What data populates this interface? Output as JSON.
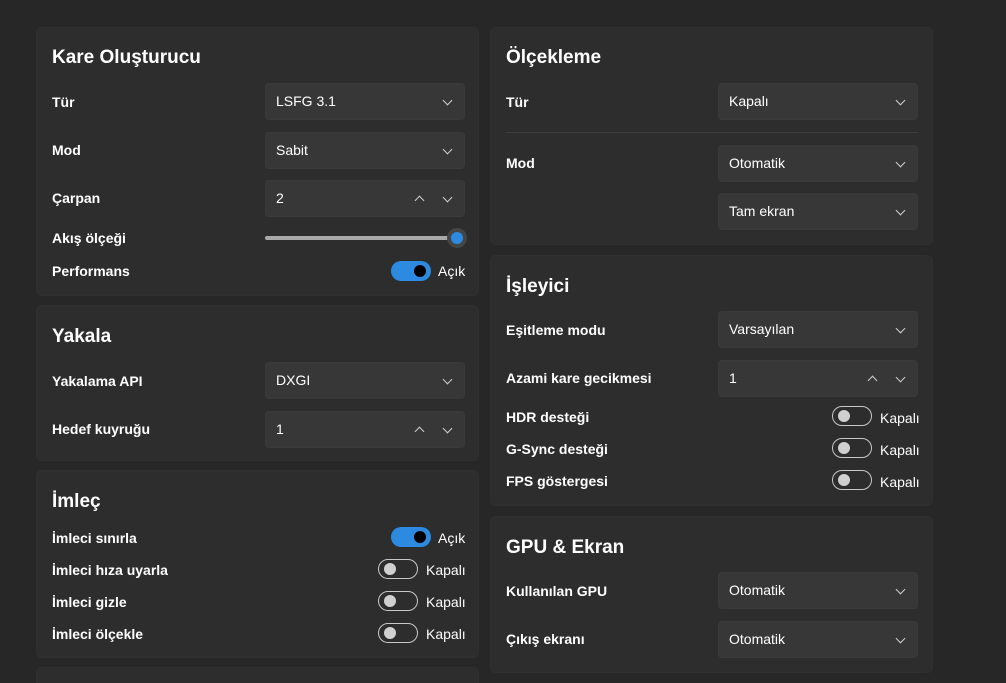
{
  "frame_gen": {
    "title": "Kare Oluşturucu",
    "type_label": "Tür",
    "type_value": "LSFG 3.1",
    "mode_label": "Mod",
    "mode_value": "Sabit",
    "multiplier_label": "Çarpan",
    "multiplier_value": "2",
    "flow_label": "Akış ölçeği",
    "flow_value": 1.0,
    "perf_label": "Performans",
    "perf_state": "Açık"
  },
  "capture": {
    "title": "Yakala",
    "api_label": "Yakalama API",
    "api_value": "DXGI",
    "queue_label": "Hedef kuyruğu",
    "queue_value": "1"
  },
  "cursor": {
    "title": "İmleç",
    "items": [
      {
        "label": "İmleci sınırla",
        "state": "Açık"
      },
      {
        "label": "İmleci hıza uyarla",
        "state": "Kapalı"
      },
      {
        "label": "İmleci gizle",
        "state": "Kapalı"
      },
      {
        "label": "İmleci ölçekle",
        "state": "Kapalı"
      }
    ]
  },
  "scaling": {
    "title": "Ölçekleme",
    "type_label": "Tür",
    "type_value": "Kapalı",
    "mode_label": "Mod",
    "mode_value": "Otomatik",
    "mode_value2": "Tam ekran"
  },
  "renderer": {
    "title": "İşleyici",
    "sync_label": "Eşitleme modu",
    "sync_value": "Varsayılan",
    "latency_label": "Azami kare gecikmesi",
    "latency_value": "1",
    "toggles": [
      {
        "label": "HDR desteği",
        "state": "Kapalı"
      },
      {
        "label": "G-Sync desteği",
        "state": "Kapalı"
      },
      {
        "label": "FPS göstergesi",
        "state": "Kapalı"
      }
    ]
  },
  "gpu": {
    "title": "GPU & Ekran",
    "gpu_label": "Kullanılan GPU",
    "gpu_value": "Otomatik",
    "output_label": "Çıkış ekranı",
    "output_value": "Otomatik"
  },
  "colors": {
    "background": "#272727",
    "card": "#2d2d2d",
    "accent": "#2c8ae0"
  }
}
